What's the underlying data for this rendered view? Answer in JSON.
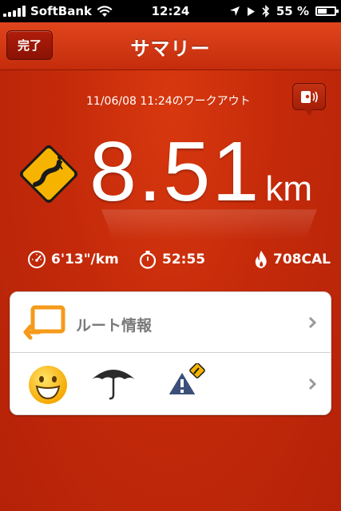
{
  "status_bar": {
    "carrier": "SoftBank",
    "time": "12:24",
    "battery_percent": "55 %",
    "battery_level": 0.55
  },
  "navbar": {
    "done_label": "完了",
    "title": "サマリー"
  },
  "workout": {
    "datetime": "11/06/08 11:24のワークアウト",
    "distance_value": "8.51",
    "distance_unit": "km"
  },
  "stats": {
    "pace": "6'13\"/km",
    "duration": "52:55",
    "calories": "708CAL"
  },
  "card": {
    "route_label": "ルート情報"
  },
  "colors": {
    "background": "#c42a0a",
    "navbar": "#d23a14",
    "sign_yellow": "#f6b400"
  },
  "icons": [
    "wifi-icon",
    "location-arrow-icon",
    "play-icon",
    "bluetooth-icon",
    "share-voice-icon",
    "winding-road-sign-icon",
    "pace-gauge-icon",
    "stopwatch-icon",
    "flame-icon",
    "route-map-icon",
    "smiley-mood-icon",
    "umbrella-weather-icon",
    "terrain-sign-icon",
    "chevron-right-icon"
  ]
}
